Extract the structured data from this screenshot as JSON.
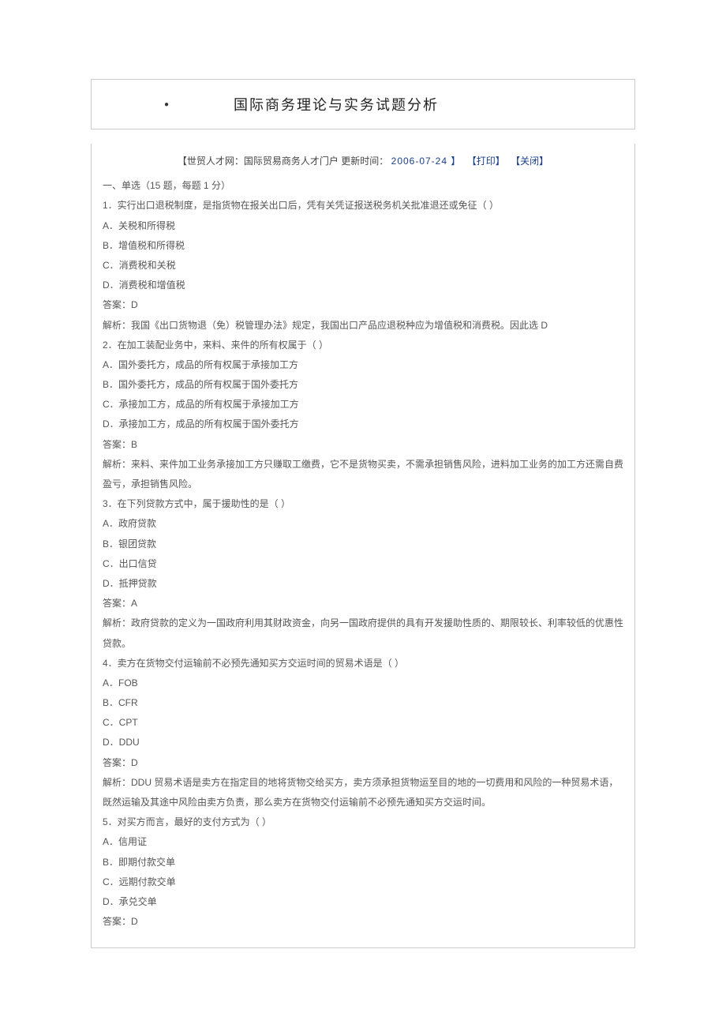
{
  "title": "国际商务理论与实务试题分析",
  "meta": {
    "source_lab": "【世贸人才网：国际贸易商务人才门户",
    "update_lab": "更新时间：",
    "date": " 2006-07-24 】",
    "print": "【打印】",
    "close": "【关闭】"
  },
  "section_heading": "一、单选（15 题，每题 1 分）",
  "questions": [
    {
      "stem": "1．实行出口退税制度，是指货物在报关出口后，凭有关凭证报送税务机关批准退还或免征（ ）",
      "opts": [
        "A．关税和所得税",
        "B．增值税和所得税",
        "C．消费税和关税",
        "D．消费税和增值税"
      ],
      "answer": "答案：D",
      "analysis": "解析：我国《出口货物退（免）税管理办法》规定，我国出口产品应退税种应为增值税和消费税。因此选 D"
    },
    {
      "stem": "2．在加工装配业务中，来料、来件的所有权属于（ ）",
      "opts": [
        "A．国外委托方，成品的所有权属于承接加工方",
        "B．国外委托方，成品的所有权属于国外委托方",
        "C．承接加工方，成品的所有权属于承接加工方",
        "D．承接加工方，成品的所有权属于国外委托方"
      ],
      "answer": "答案：B",
      "analysis": "解析：来料、来件加工业务承接加工方只赚取工缴费，它不是货物买卖，不需承担销售风险，进料加工业务的加工方还需自费盈亏，承担销售风险。"
    },
    {
      "stem": "3．在下列贷款方式中，属于援助性的是（ ）",
      "opts": [
        "A．政府贷款",
        "B．银团贷款",
        "C．出口信贷",
        "D．抵押贷款"
      ],
      "answer": "答案：A",
      "analysis": "解析：政府贷款的定义为一国政府利用其财政资金，向另一国政府提供的具有开发援助性质的、期限较长、利率较低的优惠性贷款。"
    },
    {
      "stem": "4．卖方在货物交付运输前不必预先通知买方交运时间的贸易术语是（ ）",
      "opts": [
        "A．FOB",
        "B．CFR",
        "C．CPT",
        "D．DDU"
      ],
      "answer": "答案：D",
      "analysis": "解析：DDU 贸易术语是卖方在指定目的地将货物交给买方，卖方须承担货物运至目的地的一切费用和风险的一种贸易术语，既然运输及其途中风险由卖方负责，那么卖方在货物交付运输前不必预先通知买方交运时间。"
    },
    {
      "stem": "5．对买方而言，最好的支付方式为（ ）",
      "opts": [
        "A．信用证",
        "B．即期付款交单",
        "C．远期付款交单",
        "D．承兑交单"
      ],
      "answer": "答案：D",
      "analysis": ""
    }
  ]
}
